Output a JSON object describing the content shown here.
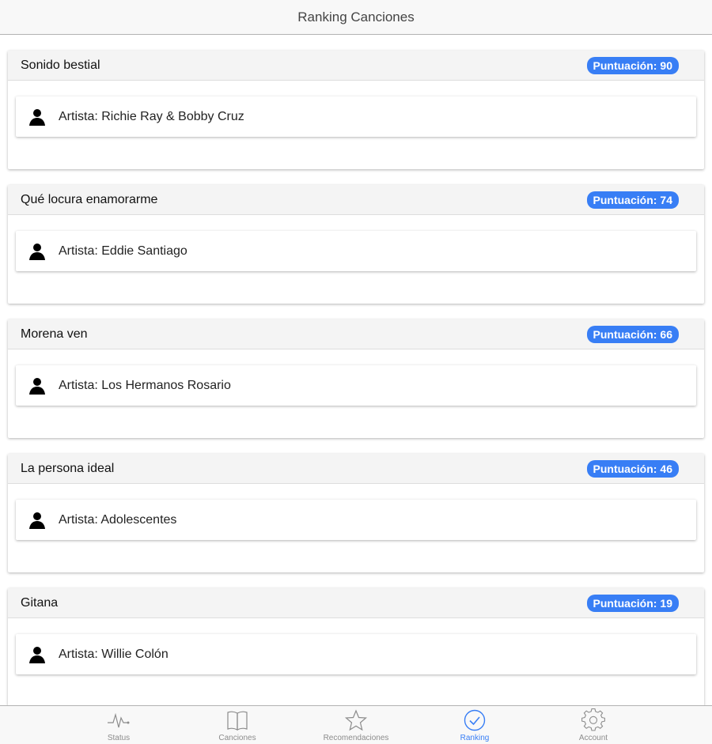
{
  "header": {
    "title": "Ranking Canciones"
  },
  "songs": [
    {
      "title": "Sonido bestial",
      "score_label": "Puntuación:",
      "score": 90,
      "artist_label": "Artista:",
      "artist": "Richie Ray & Bobby Cruz"
    },
    {
      "title": "Qué locura enamorarme",
      "score_label": "Puntuación:",
      "score": 74,
      "artist_label": "Artista:",
      "artist": "Eddie Santiago"
    },
    {
      "title": "Morena ven",
      "score_label": "Puntuación:",
      "score": 66,
      "artist_label": "Artista:",
      "artist": "Los Hermanos Rosario"
    },
    {
      "title": "La persona ideal",
      "score_label": "Puntuación:",
      "score": 46,
      "artist_label": "Artista:",
      "artist": "Adolescentes"
    },
    {
      "title": "Gitana",
      "score_label": "Puntuación:",
      "score": 19,
      "artist_label": "Artista:",
      "artist": "Willie Colón"
    }
  ],
  "tabs": [
    {
      "label": "Status",
      "icon": "pulse-icon",
      "active": false
    },
    {
      "label": "Canciones",
      "icon": "book-icon",
      "active": false
    },
    {
      "label": "Recomendaciones",
      "icon": "star-icon",
      "active": false
    },
    {
      "label": "Ranking",
      "icon": "checkmark-circle-icon",
      "active": true
    },
    {
      "label": "Account",
      "icon": "gear-icon",
      "active": false
    }
  ],
  "colors": {
    "accent": "#387ef5",
    "inactive": "#8c8c8c"
  }
}
